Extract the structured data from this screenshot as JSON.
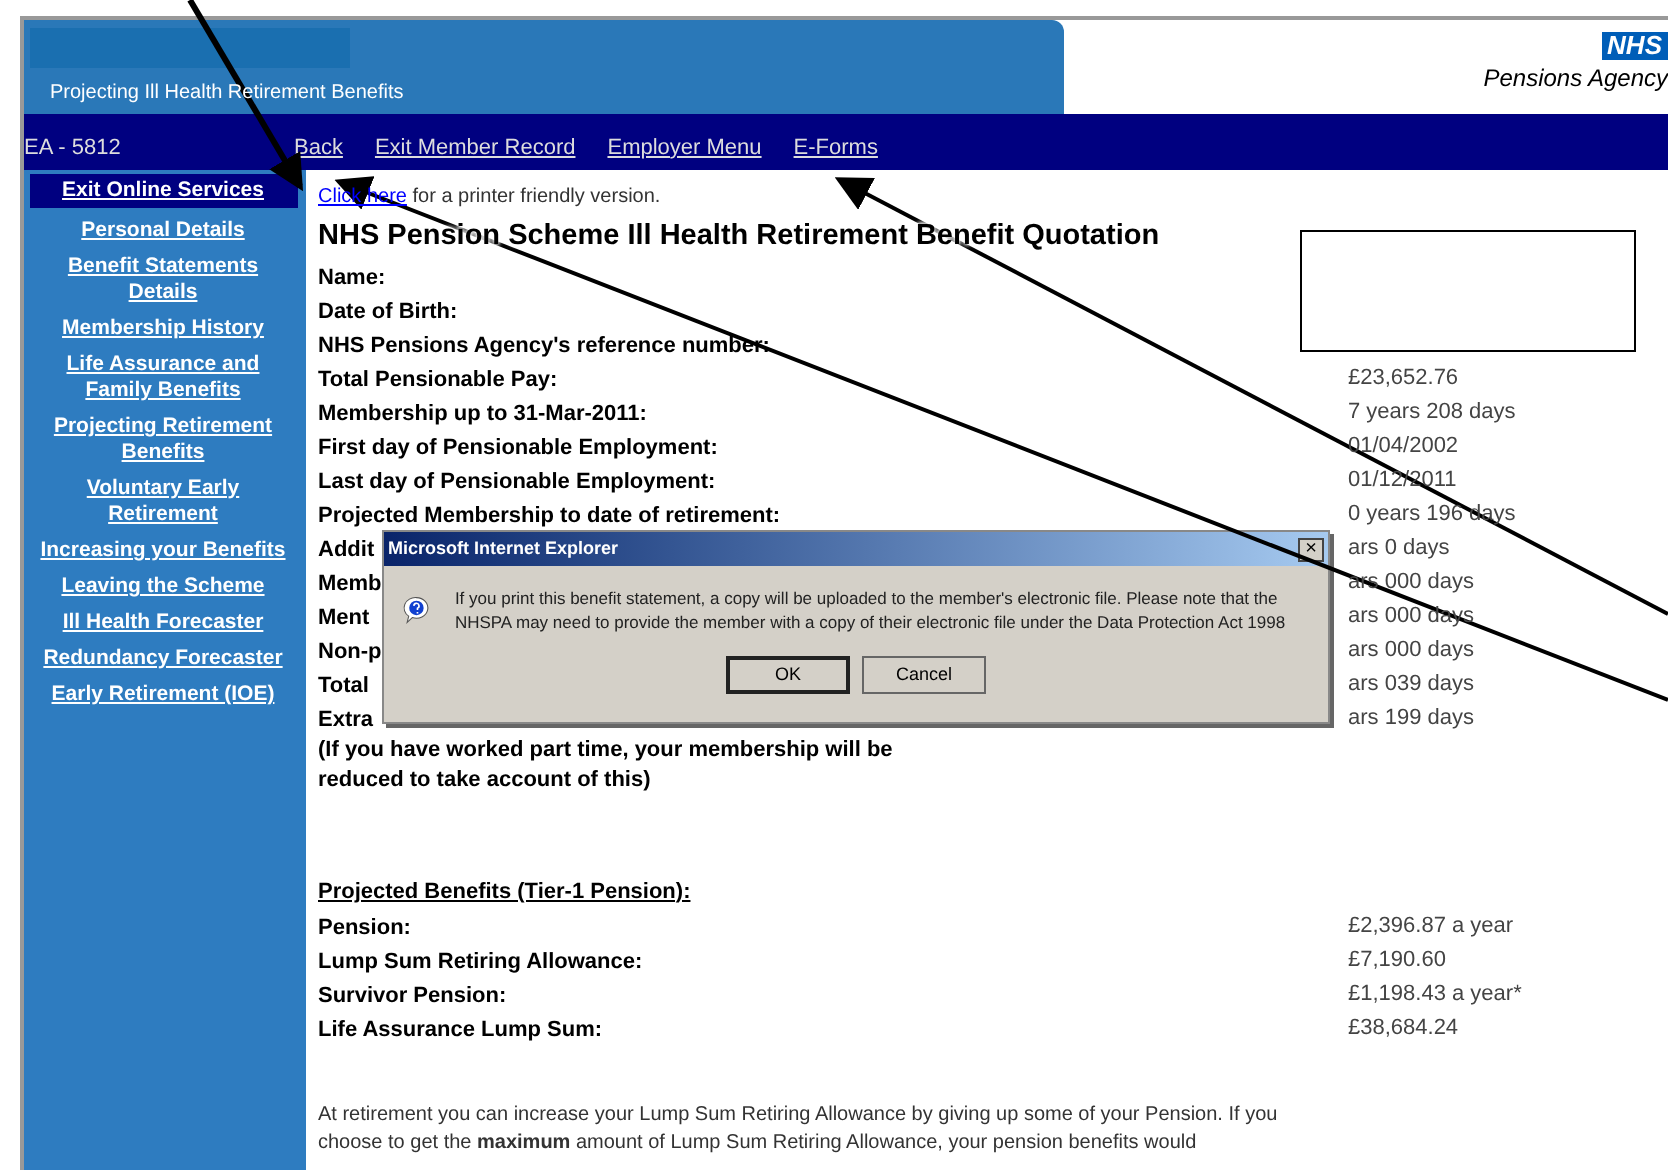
{
  "header": {
    "title": "Projecting Ill Health Retirement Benefits",
    "logo_text": "NHS",
    "agency": "Pensions Agency"
  },
  "nav": {
    "member_ref": "EA - 5812",
    "links": [
      "Back",
      "Exit Member Record",
      "Employer Menu",
      "E-Forms"
    ]
  },
  "sidebar": {
    "items": [
      {
        "label": "Exit Online Services",
        "selected": true
      },
      {
        "label": "Personal Details",
        "selected": false
      },
      {
        "label": "Benefit Statements Details",
        "selected": false
      },
      {
        "label": "Membership History",
        "selected": false
      },
      {
        "label": "Life Assurance and Family Benefits",
        "selected": false
      },
      {
        "label": "Projecting Retirement Benefits",
        "selected": false
      },
      {
        "label": "Voluntary Early Retirement",
        "selected": false
      },
      {
        "label": "Increasing your Benefits",
        "selected": false
      },
      {
        "label": "Leaving the Scheme",
        "selected": false
      },
      {
        "label": "Ill Health Forecaster",
        "selected": false
      },
      {
        "label": "Redundancy Forecaster",
        "selected": false
      },
      {
        "label": "Early Retirement (IOE)",
        "selected": false
      }
    ]
  },
  "content": {
    "printer_link": "Click here",
    "printer_text": "for a printer friendly version.",
    "title": "NHS Pension Scheme Ill Health Retirement Benefit Quotation",
    "details": [
      {
        "label": "Name:"
      },
      {
        "label": "Date of Birth:"
      },
      {
        "label": "NHS Pensions Agency's reference number:"
      },
      {
        "label": "Total Pensionable Pay:",
        "value": "£23,652.76"
      },
      {
        "label": "Membership up to 31-Mar-2011:",
        "value": "7 years 208 days"
      },
      {
        "label": "First day of Pensionable Employment:",
        "value": "01/04/2002"
      },
      {
        "label": "Last day of Pensionable Employment:",
        "value": "01/12/2011"
      },
      {
        "label": "Projected Membership to date of retirement:",
        "value": "0 years 196 days"
      },
      {
        "label": "Addit",
        "value": "ars 0 days"
      },
      {
        "label": "Memb",
        "value": "ars 000 days"
      },
      {
        "label": "Ment",
        "value": "ars 000 days"
      },
      {
        "label": "Non-p",
        "value": "ars 000 days"
      },
      {
        "label": "Total",
        "value": "ars 039 days"
      },
      {
        "label": "Extra",
        "value": "ars 199 days"
      }
    ],
    "note": "(If you have worked part time, your membership will be reduced to take account of this)",
    "benefits_heading": "Projected Benefits (Tier-1 Pension):",
    "benefits": [
      {
        "label": "Pension:",
        "value": "£2,396.87 a year"
      },
      {
        "label": "Lump Sum Retiring Allowance:",
        "value": "£7,190.60"
      },
      {
        "label": "Survivor Pension:",
        "value": "£1,198.43 a year*"
      },
      {
        "label": "Life Assurance Lump Sum:",
        "value": "£38,684.24"
      }
    ],
    "paragraph": "At retirement you can increase your Lump Sum Retiring Allowance by giving up some of your Pension. If you choose to get the **maximum** amount of Lump Sum Retiring Allowance, your pension benefits would"
  },
  "dialog": {
    "title": "Microsoft Internet Explorer",
    "close": "×",
    "message": "If you print this benefit statement, a copy will be uploaded to the member's electronic file. Please note that the NHSPA may need to provide the member with a copy of their electronic file under the Data Protection Act 1998",
    "buttons": [
      "OK",
      "Cancel"
    ]
  }
}
